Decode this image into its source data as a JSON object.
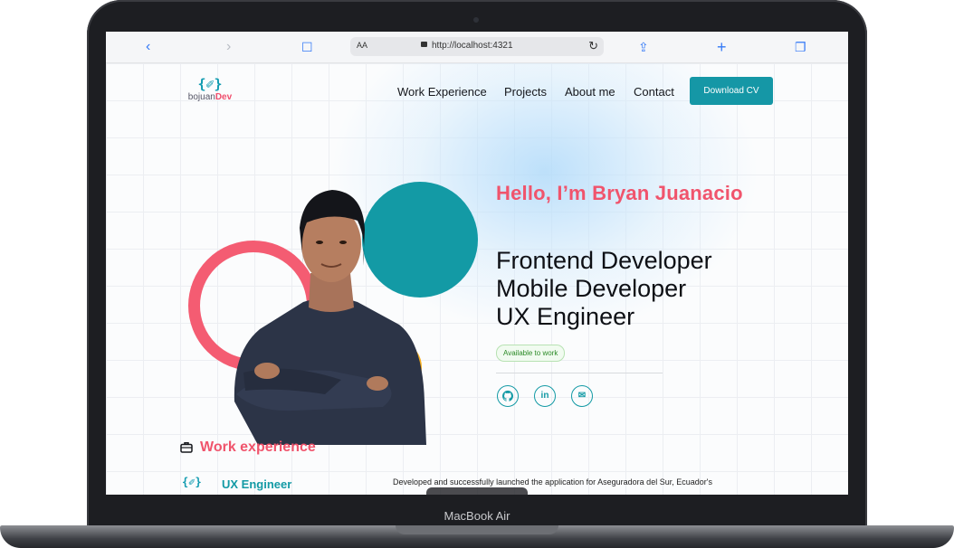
{
  "device": {
    "label": "MacBook Air"
  },
  "browser": {
    "back_icon": "chevron-left-icon",
    "forward_icon": "chevron-right-icon",
    "bookmarks_icon": "book-icon",
    "reader_label": "AA",
    "url": "http://localhost:4321",
    "reload_icon": "reload-icon",
    "share_icon": "share-icon",
    "new_tab_icon": "plus-icon",
    "tabs_icon": "tabs-icon"
  },
  "site": {
    "logo_brace": "{✐}",
    "logo_name": "bojuan",
    "logo_dev": "Dev",
    "nav": [
      "Work Experience",
      "Projects",
      "About me",
      "Contact"
    ],
    "cta_label": "Download CV"
  },
  "hero": {
    "greeting": "Hello, I’m Bryan Juanacio",
    "roles": [
      "Frontend Developer",
      "Mobile Developer",
      "UX Engineer"
    ],
    "status_badge": "Available to work",
    "social": [
      {
        "name": "github-icon",
        "glyph": "⚉"
      },
      {
        "name": "linkedin-icon",
        "glyph": "in"
      },
      {
        "name": "mail-icon",
        "glyph": "✉"
      }
    ]
  },
  "work": {
    "section_title": "Work experience",
    "section_icon": "briefcase-icon",
    "jobs": [
      {
        "title": "UX Engineer",
        "description": "Developed and successfully launched the application for Aseguradora del Sur, Ecuador's"
      }
    ]
  },
  "colors": {
    "accent_teal": "#139aa5",
    "accent_red": "#f0546c",
    "accent_yellow": "#f6ad1c"
  }
}
